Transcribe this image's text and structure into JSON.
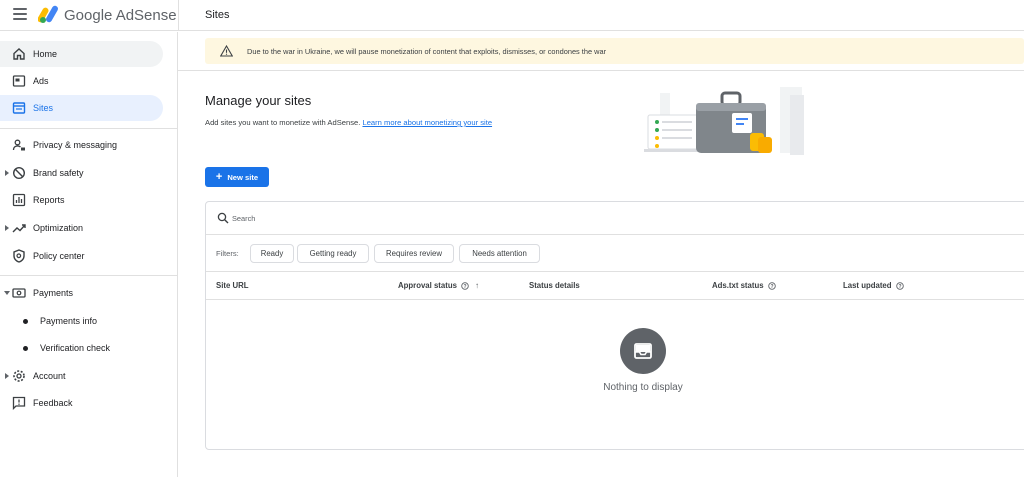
{
  "app": {
    "brand": "Google AdSense",
    "page_title": "Sites"
  },
  "sidebar": {
    "items": [
      {
        "label": "Home"
      },
      {
        "label": "Ads"
      },
      {
        "label": "Sites"
      },
      {
        "label": "Privacy & messaging"
      },
      {
        "label": "Brand safety"
      },
      {
        "label": "Reports"
      },
      {
        "label": "Optimization"
      },
      {
        "label": "Policy center"
      },
      {
        "label": "Payments"
      },
      {
        "label": "Payments info"
      },
      {
        "label": "Verification check"
      },
      {
        "label": "Account"
      },
      {
        "label": "Feedback"
      }
    ]
  },
  "banner": {
    "text": "Due to the war in Ukraine, we will pause monetization of content that exploits, dismisses, or condones the war"
  },
  "main": {
    "title": "Manage your sites",
    "subtitle": "Add sites you want to monetize with AdSense.",
    "learn_more": "Learn more about monetizing your site",
    "new_site_label": "New site"
  },
  "table": {
    "search_placeholder": "Search",
    "filters_label": "Filters:",
    "filters": [
      "Ready",
      "Getting ready",
      "Requires review",
      "Needs attention"
    ],
    "columns": [
      "Site URL",
      "Approval status",
      "Status details",
      "Ads.txt status",
      "Last updated"
    ],
    "empty_text": "Nothing to display"
  },
  "colors": {
    "accent": "#1a73e8",
    "banner_bg": "#fef7e0",
    "active_nav_bg": "#e8f0fe"
  }
}
